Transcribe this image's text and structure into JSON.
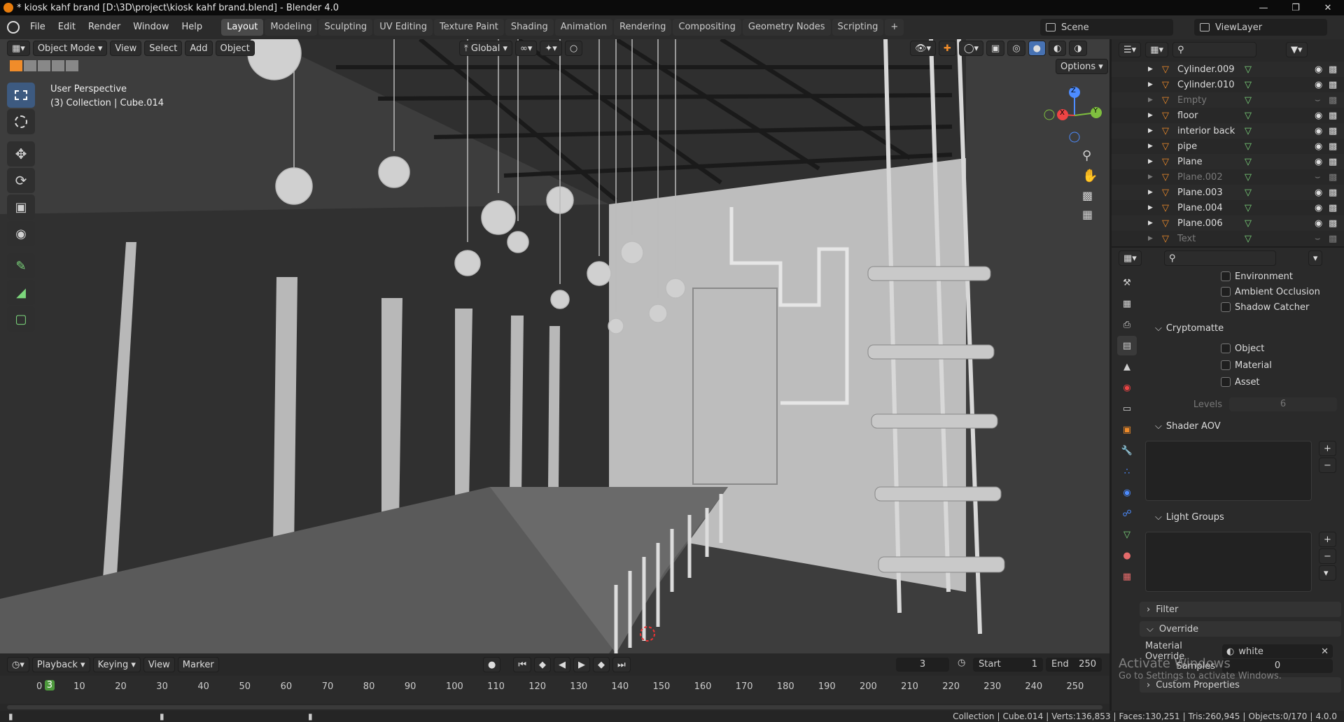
{
  "title": "* kiosk kahf brand [D:\\3D\\project\\kiosk kahf brand.blend] - Blender 4.0",
  "menu": [
    "File",
    "Edit",
    "Render",
    "Window",
    "Help"
  ],
  "workspaces": [
    "Layout",
    "Modeling",
    "Sculpting",
    "UV Editing",
    "Texture Paint",
    "Shading",
    "Animation",
    "Rendering",
    "Compositing",
    "Geometry Nodes",
    "Scripting"
  ],
  "active_workspace": "Layout",
  "scene_label": "Scene",
  "viewlayer_label": "ViewLayer",
  "viewport": {
    "mode": "Object Mode",
    "menus": [
      "View",
      "Select",
      "Add",
      "Object"
    ],
    "orientation": "Global",
    "options": "Options",
    "info_line1": "User Perspective",
    "info_line2": "(3) Collection | Cube.014",
    "gizmo": {
      "x": "X",
      "y": "Y",
      "z": "Z"
    }
  },
  "outliner": {
    "rows": [
      {
        "name": "Cylinder.009",
        "dim": false
      },
      {
        "name": "Cylinder.010",
        "dim": false
      },
      {
        "name": "Empty",
        "dim": true
      },
      {
        "name": "floor",
        "dim": false
      },
      {
        "name": "interior back",
        "dim": false
      },
      {
        "name": "pipe",
        "dim": false
      },
      {
        "name": "Plane",
        "dim": false
      },
      {
        "name": "Plane.002",
        "dim": true
      },
      {
        "name": "Plane.003",
        "dim": false
      },
      {
        "name": "Plane.004",
        "dim": false
      },
      {
        "name": "Plane.006",
        "dim": false
      },
      {
        "name": "Text",
        "dim": true
      }
    ]
  },
  "properties": {
    "passes": [
      "Environment",
      "Ambient Occlusion",
      "Shadow Catcher"
    ],
    "cryptomatte_label": "Cryptomatte",
    "cryptomatte": [
      "Object",
      "Material",
      "Asset"
    ],
    "levels_label": "Levels",
    "levels_value": "6",
    "shader_aov": "Shader AOV",
    "light_groups": "Light Groups",
    "filter": "Filter",
    "override": "Override",
    "material_override_label": "Material Override",
    "material_override_value": "white",
    "samples_label": "Samples",
    "samples_value": "0",
    "custom_properties": "Custom Properties",
    "activate_title": "Activate Windows",
    "activate_sub": "Go to Settings to activate Windows."
  },
  "timeline": {
    "menus": [
      "Playback",
      "Keying",
      "View",
      "Marker"
    ],
    "current_frame": "3",
    "start_label": "Start",
    "start": "1",
    "end_label": "End",
    "end": "250",
    "ticks": [
      "0",
      "10",
      "20",
      "30",
      "40",
      "50",
      "60",
      "70",
      "80",
      "90",
      "100",
      "110",
      "120",
      "130",
      "140",
      "150",
      "160",
      "170",
      "180",
      "190",
      "200",
      "210",
      "220",
      "230",
      "240",
      "250"
    ]
  },
  "status": {
    "collection": "Collection",
    "object": "Cube.014",
    "verts": "Verts:136,853",
    "faces": "Faces:130,251",
    "tris": "Tris:260,945",
    "objects": "Objects:0/170",
    "version": "4.0.0"
  },
  "colors": {
    "accent": "#4772b3",
    "active_tab": "#4a4a4a",
    "selected_orange": "#f08c2a"
  }
}
